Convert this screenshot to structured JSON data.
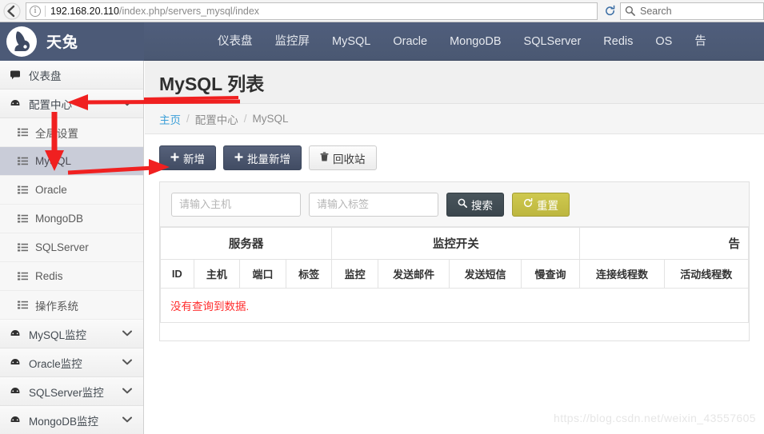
{
  "browser": {
    "url_host": "192.168.20.110",
    "url_path": "/index.php/servers_mysql/index",
    "search_placeholder": "Search",
    "back_icon": "back-arrow-icon",
    "info_icon": "info-icon",
    "reload_icon": "reload-icon",
    "search_icon": "search-icon"
  },
  "topnav": {
    "brand": "天兔",
    "links": [
      "仪表盘",
      "监控屏",
      "MySQL",
      "Oracle",
      "MongoDB",
      "SQLServer",
      "Redis",
      "OS",
      "告"
    ]
  },
  "sidebar": {
    "items": [
      {
        "label": "仪表盘",
        "icon": "comment-icon",
        "type": "group",
        "expandable": false
      },
      {
        "label": "配置中心",
        "icon": "dashboard-icon",
        "type": "group",
        "expandable": true,
        "expanded": true
      },
      {
        "label": "全局设置",
        "icon": "list-icon",
        "type": "sub",
        "active": false
      },
      {
        "label": "MySQL",
        "icon": "list-icon",
        "type": "sub",
        "active": true
      },
      {
        "label": "Oracle",
        "icon": "list-icon",
        "type": "sub",
        "active": false
      },
      {
        "label": "MongoDB",
        "icon": "list-icon",
        "type": "sub",
        "active": false
      },
      {
        "label": "SQLServer",
        "icon": "list-icon",
        "type": "sub",
        "active": false
      },
      {
        "label": "Redis",
        "icon": "list-icon",
        "type": "sub",
        "active": false
      },
      {
        "label": "操作系统",
        "icon": "list-icon",
        "type": "sub",
        "active": false
      },
      {
        "label": "MySQL监控",
        "icon": "dashboard-icon",
        "type": "group",
        "expandable": true,
        "expanded": false
      },
      {
        "label": "Oracle监控",
        "icon": "dashboard-icon",
        "type": "group",
        "expandable": true,
        "expanded": false
      },
      {
        "label": "SQLServer监控",
        "icon": "dashboard-icon",
        "type": "group",
        "expandable": true,
        "expanded": false
      },
      {
        "label": "MongoDB监控",
        "icon": "dashboard-icon",
        "type": "group",
        "expandable": true,
        "expanded": false
      }
    ]
  },
  "page": {
    "title": "MySQL 列表",
    "breadcrumb": {
      "home": "主页",
      "sep": "/",
      "items": [
        "配置中心",
        "MySQL"
      ]
    }
  },
  "toolbar": {
    "add_label": "新增",
    "batch_add_label": "批量新增",
    "recycle_label": "回收站",
    "add_icon": "plus-icon",
    "batch_add_icon": "plus-icon",
    "recycle_icon": "trash-icon"
  },
  "filter": {
    "host_placeholder": "请输入主机",
    "host_value": "",
    "tag_placeholder": "请输入标签",
    "tag_value": "",
    "search_label": "搜索",
    "search_icon": "search-icon",
    "reset_label": "重置",
    "reset_icon": "refresh-icon"
  },
  "table": {
    "group_headers": [
      {
        "label": "服务器",
        "colspan": 4
      },
      {
        "label": "监控开关",
        "colspan": 4
      },
      {
        "label": "告",
        "colspan": 2
      }
    ],
    "columns": [
      "ID",
      "主机",
      "端口",
      "标签",
      "监控",
      "发送邮件",
      "发送短信",
      "慢查询",
      "连接线程数",
      "活动线程数"
    ],
    "rows": [],
    "empty_message": "没有查询到数据."
  },
  "annotations": {
    "arrow_color": "#f02020",
    "title_underline": true,
    "arrows": [
      "arrow-to-config-center",
      "arrow-config-to-mysql",
      "arrow-to-add-button"
    ]
  },
  "watermark": "https://blog.csdn.net/weixin_43557605"
}
